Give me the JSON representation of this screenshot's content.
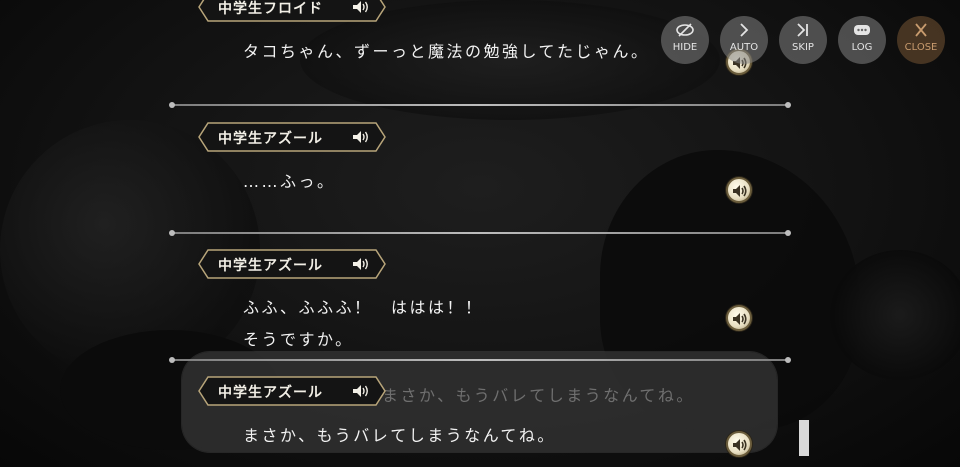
{
  "menu": {
    "hide_label": "HIDE",
    "auto_label": "AUTO",
    "skip_label": "SKIP",
    "log_label": "LOG",
    "close_label": "CLOSE"
  },
  "log_entries": [
    {
      "speaker": "中学生フロイド",
      "lines": [
        "タコちゃん、ずーっと魔法の勉強してたじゃん。"
      ]
    },
    {
      "speaker": "中学生アズール",
      "lines": [
        "……ふっ。"
      ]
    },
    {
      "speaker": "中学生アズール",
      "lines": [
        "ふふ、ふふふ！　ははは！！",
        "そうですか。"
      ]
    },
    {
      "speaker": "中学生アズール",
      "lines": [
        "まさか、もうバレてしまうなんてね。"
      ]
    }
  ],
  "dialog": {
    "speaker": "中学生アズール",
    "text": "まさか、もうバレてしまうなんてね。"
  },
  "colors": {
    "text": "#f2f2f2",
    "namebox_border": "#b8a57a",
    "voice_button": "#e8dfc2"
  }
}
